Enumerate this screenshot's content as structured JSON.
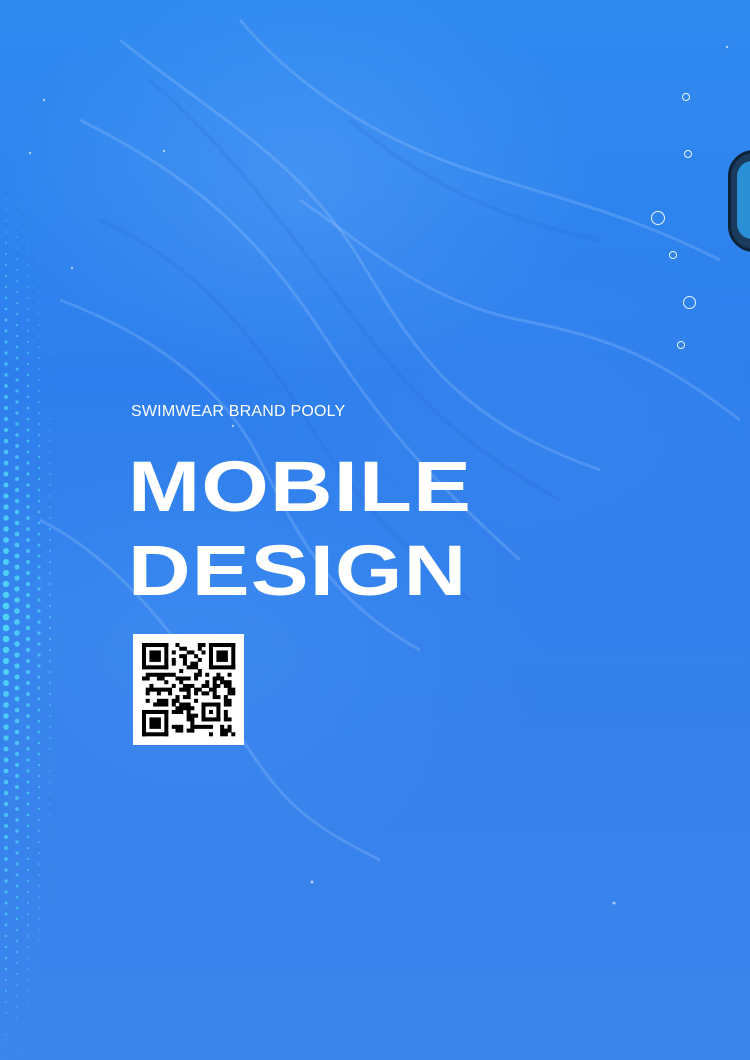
{
  "poster": {
    "subtitle": "SWIMWEAR BRAND POOLY",
    "title_line1": "MOBILE",
    "title_line2": "DESIGN",
    "qr_icon": "qr-code-icon"
  },
  "colors": {
    "background": "#2e7fed",
    "text": "#ffffff",
    "dots": "#4fd4f5"
  }
}
